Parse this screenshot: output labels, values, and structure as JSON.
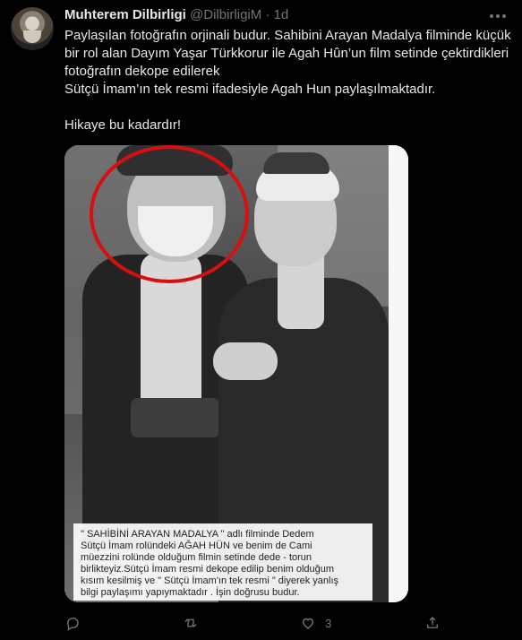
{
  "user": {
    "name": "Muhterem Dilbirligi",
    "handle": "@DilbirligiM",
    "separator": "·",
    "time": "1d"
  },
  "tweet": {
    "line1": "Paylaşılan fotoğrafın orjinali budur. Sahibini Arayan Madalya filminde küçük",
    "line2": "bir rol alan Dayım Yaşar Türkkorur ile Agah Hûn’un film setinde çektirdikleri",
    "line3": "fotoğrafın dekope edilerek",
    "line4": "Sütçü İmam’ın tek resmi ifadesiyle Agah Hun paylaşılmaktadır.",
    "line5": "Hikaye bu kadardır!"
  },
  "media": {
    "caption_lines": [
      "\" SAHİBİNİ ARAYAN MADALYA \"  adlı filminde Dedem",
      "Sütçü İmam rolündeki AĞAH HÜN ve benim de Cami",
      "müezzini rolünde olduğum  filmin setinde dede - torun",
      "birlikteyiz.Sütçü İmam resmi dekope edilip benim olduğum",
      "kısım kesilmiş ve \" Sütçü İmam'ın tek resmi \" diyerek yanlış",
      "bilgi paylaşımı yapıymaktadır . İşin doğrusu budur."
    ]
  },
  "actions": {
    "reply_count": "",
    "retweet_count": "",
    "like_count": "3",
    "share_count": ""
  },
  "icons": {
    "more": "more-icon",
    "reply": "reply-icon",
    "retweet": "retweet-icon",
    "like": "heart-icon",
    "share": "share-icon"
  }
}
